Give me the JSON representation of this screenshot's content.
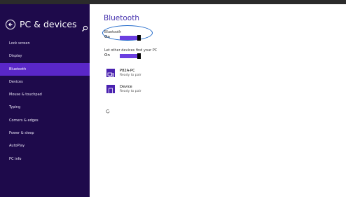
{
  "sidebar": {
    "title": "PC & devices",
    "items": [
      {
        "label": "Lock screen"
      },
      {
        "label": "Display"
      },
      {
        "label": "Bluetooth",
        "active": true
      },
      {
        "label": "Devices"
      },
      {
        "label": "Mouse & touchpad"
      },
      {
        "label": "Typing"
      },
      {
        "label": "Corners & edges"
      },
      {
        "label": "Power & sleep"
      },
      {
        "label": "AutoPlay"
      },
      {
        "label": "PC info"
      }
    ]
  },
  "main": {
    "title": "Bluetooth",
    "bluetooth_toggle": {
      "label": "Bluetooth",
      "state": "On"
    },
    "discover_toggle": {
      "label": "Let other devices find your PC",
      "state": "On"
    },
    "devices": [
      {
        "name": "P82A-PC",
        "status": "Ready to pair",
        "icon": "computer-icon"
      },
      {
        "name": "Device",
        "status": "Ready to pair",
        "icon": "tablet-icon"
      }
    ]
  },
  "colors": {
    "sidebar_bg": "#1e0a4b",
    "active_item": "#5a27c8",
    "accent": "#6b3fe0",
    "annotation": "#1f68c9"
  }
}
